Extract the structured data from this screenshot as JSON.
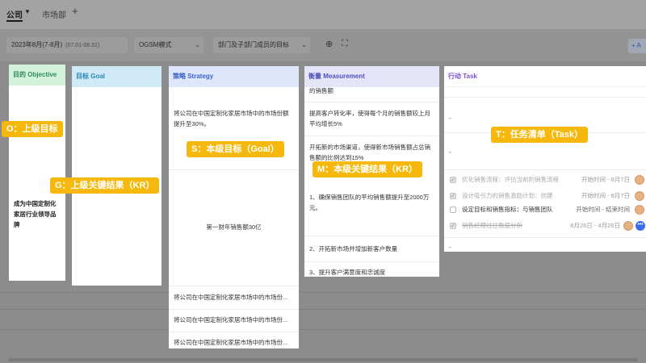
{
  "tabs": {
    "active": "公司",
    "second": "市场部",
    "add": "+"
  },
  "filters": {
    "period_label": "2023年8月(7-8月)",
    "period_range": "(07.01-08.31)",
    "mode": "OGSM模式",
    "scope": "部门及子部门成员的目标",
    "top_add": "+ A"
  },
  "columns": {
    "objective": {
      "header": "目的 Objective",
      "content": "成为中国定制化家居行业领导品牌"
    },
    "goal": {
      "header": "目标 Goal"
    },
    "strategy": {
      "header": "策略 Strategy",
      "main": "将公司在中国定制化家居市场中的市场份额提升至30%。",
      "center": "第一财年销售额30亿",
      "rows": [
        "将公司在中国定制化家居市场中的市场份...",
        "将公司在中国定制化家居市场中的市场份...",
        "将公司在中国定制化家居市场中的市场份..."
      ]
    },
    "measurement": {
      "header": "衡量 Measurement",
      "rows": [
        "的销售额",
        "提高客户转化率，使得每个月的销售额较上月平均增长5%",
        "开拓新的市场渠道，使得新市场销售额占总销售额的比例达到15%",
        "1、确保销售团队的平均销售额提升至2000万元。",
        "2、开拓新市场并增加新客户数量",
        "3、提升客户满意度和忠诚度"
      ]
    },
    "task": {
      "header": "行动 Task",
      "dashes": [
        "-",
        "-",
        "-"
      ],
      "items": [
        {
          "name": "优化销售流程：评估当前的销售流程",
          "time": "开始时间 - 8月7日",
          "done": true,
          "strike": false
        },
        {
          "name": "设计吸引力的销售激励计划：创建",
          "time": "开始时间 - 8月7日",
          "done": true,
          "strike": false
        },
        {
          "name": "设定目标和销售指标：与销售团队",
          "time": "开始时间 - 结束时间",
          "done": false,
          "strike": false
        },
        {
          "name": "销售经理过往数据分析",
          "time": "8月26日 - 4月26日",
          "done": true,
          "strike": true
        }
      ]
    }
  },
  "annotations": {
    "o": "O：上级目标",
    "g": "G：上级关键结果（KR）",
    "s": "S：本级目标（Goal）",
    "m": "M：本级关键结果（KR）",
    "t": "T：任务清单（Task）"
  },
  "colors": {
    "objective": "#2e8b57",
    "goal": "#2a87b8",
    "strategy": "#3a60c9",
    "measurement": "#4d4fb8",
    "task": "#7e4cd4",
    "badge": "#f6b80c"
  }
}
